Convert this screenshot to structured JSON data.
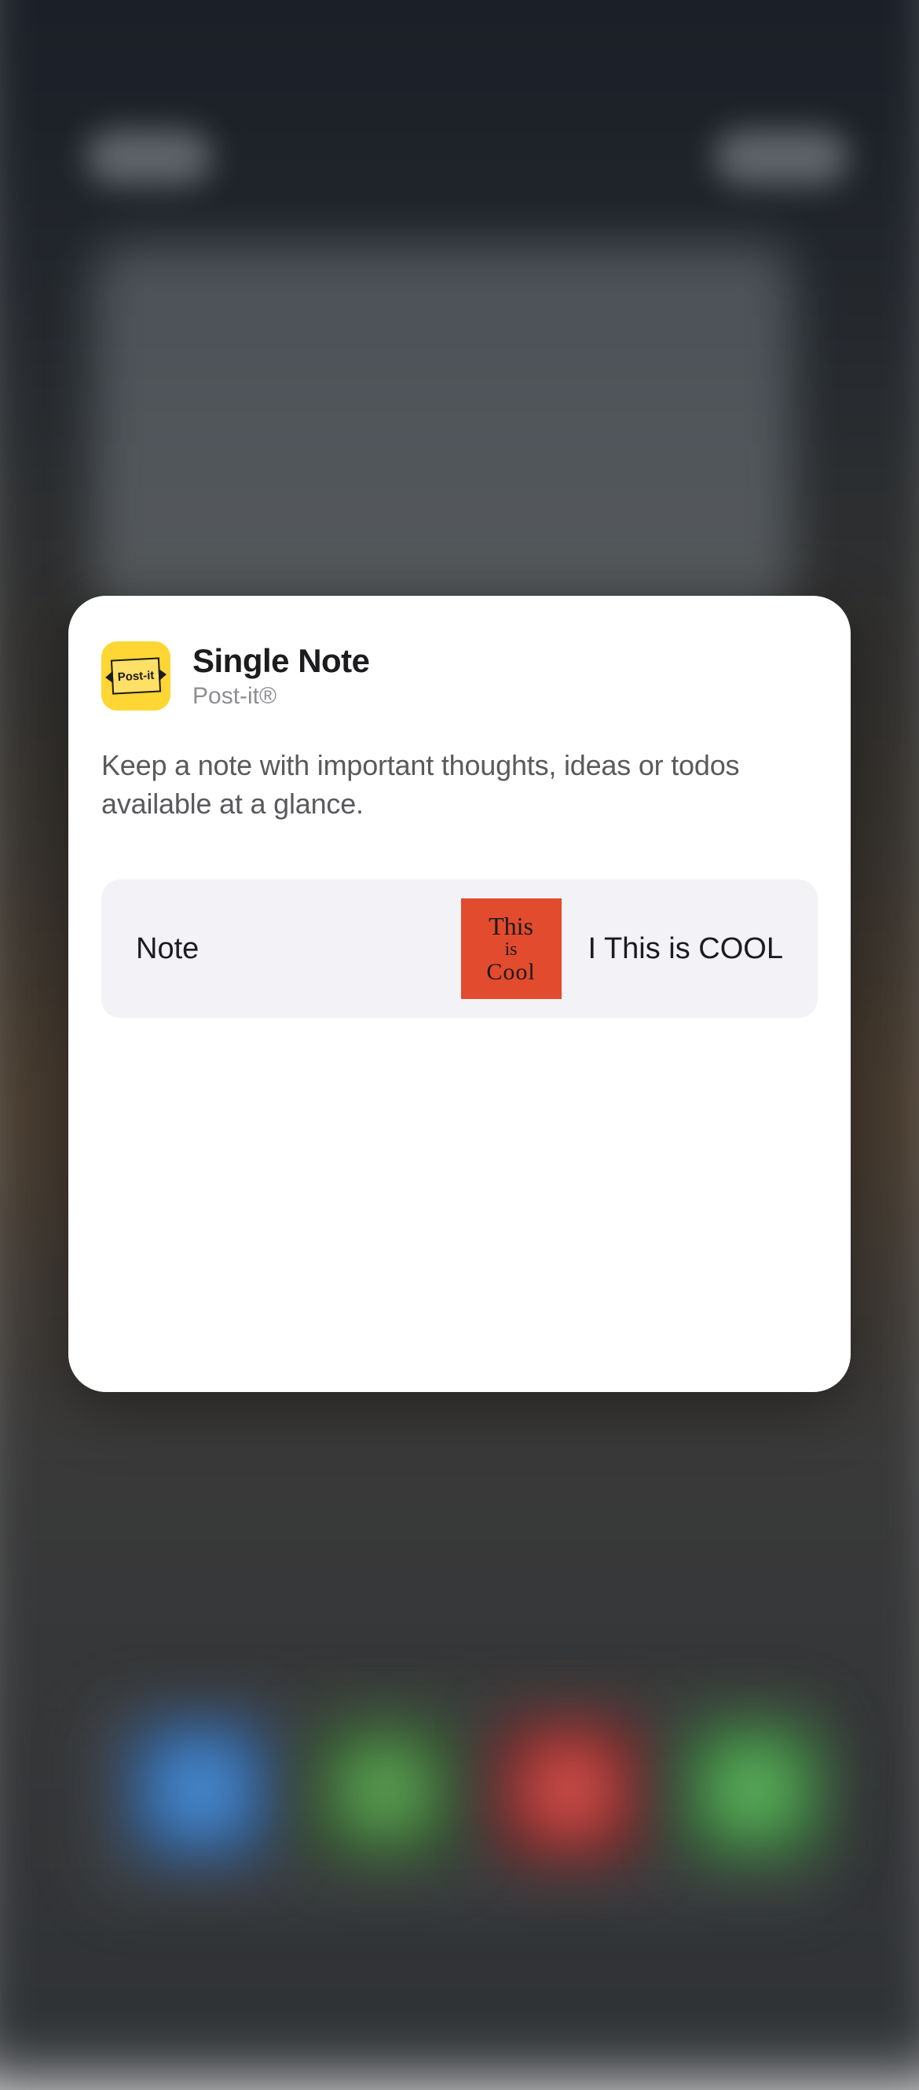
{
  "widget": {
    "title": "Single Note",
    "publisher": "Post-it®",
    "description": "Keep a note with important thoughts, ideas or todos available at a glance.",
    "app_icon_label": "Post-it"
  },
  "option": {
    "label": "Note",
    "value": "I This is COOL",
    "thumbnail": {
      "line1": "This",
      "line2": "is",
      "line3": "Cool",
      "color": "#e24b2e"
    }
  }
}
